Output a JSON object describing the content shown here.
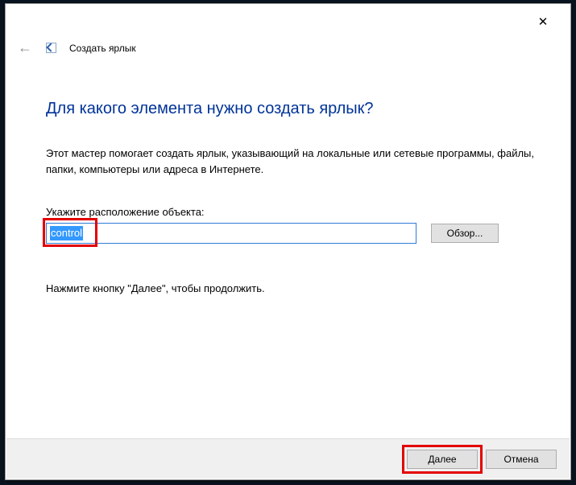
{
  "window": {
    "title": "Создать ярлык"
  },
  "wizard": {
    "heading": "Для какого элемента нужно создать ярлык?",
    "description": "Этот мастер помогает создать ярлык, указывающий на локальные или сетевые программы, файлы, папки, компьютеры или адреса в Интернете.",
    "location_label": "Укажите расположение объекта:",
    "location_value": "control",
    "browse_label": "Обзор...",
    "continue_hint": "Нажмите кнопку \"Далее\", чтобы продолжить."
  },
  "footer": {
    "next_label": "Далее",
    "cancel_label": "Отмена"
  },
  "annotations": {
    "highlight_input": true,
    "highlight_next": true
  }
}
